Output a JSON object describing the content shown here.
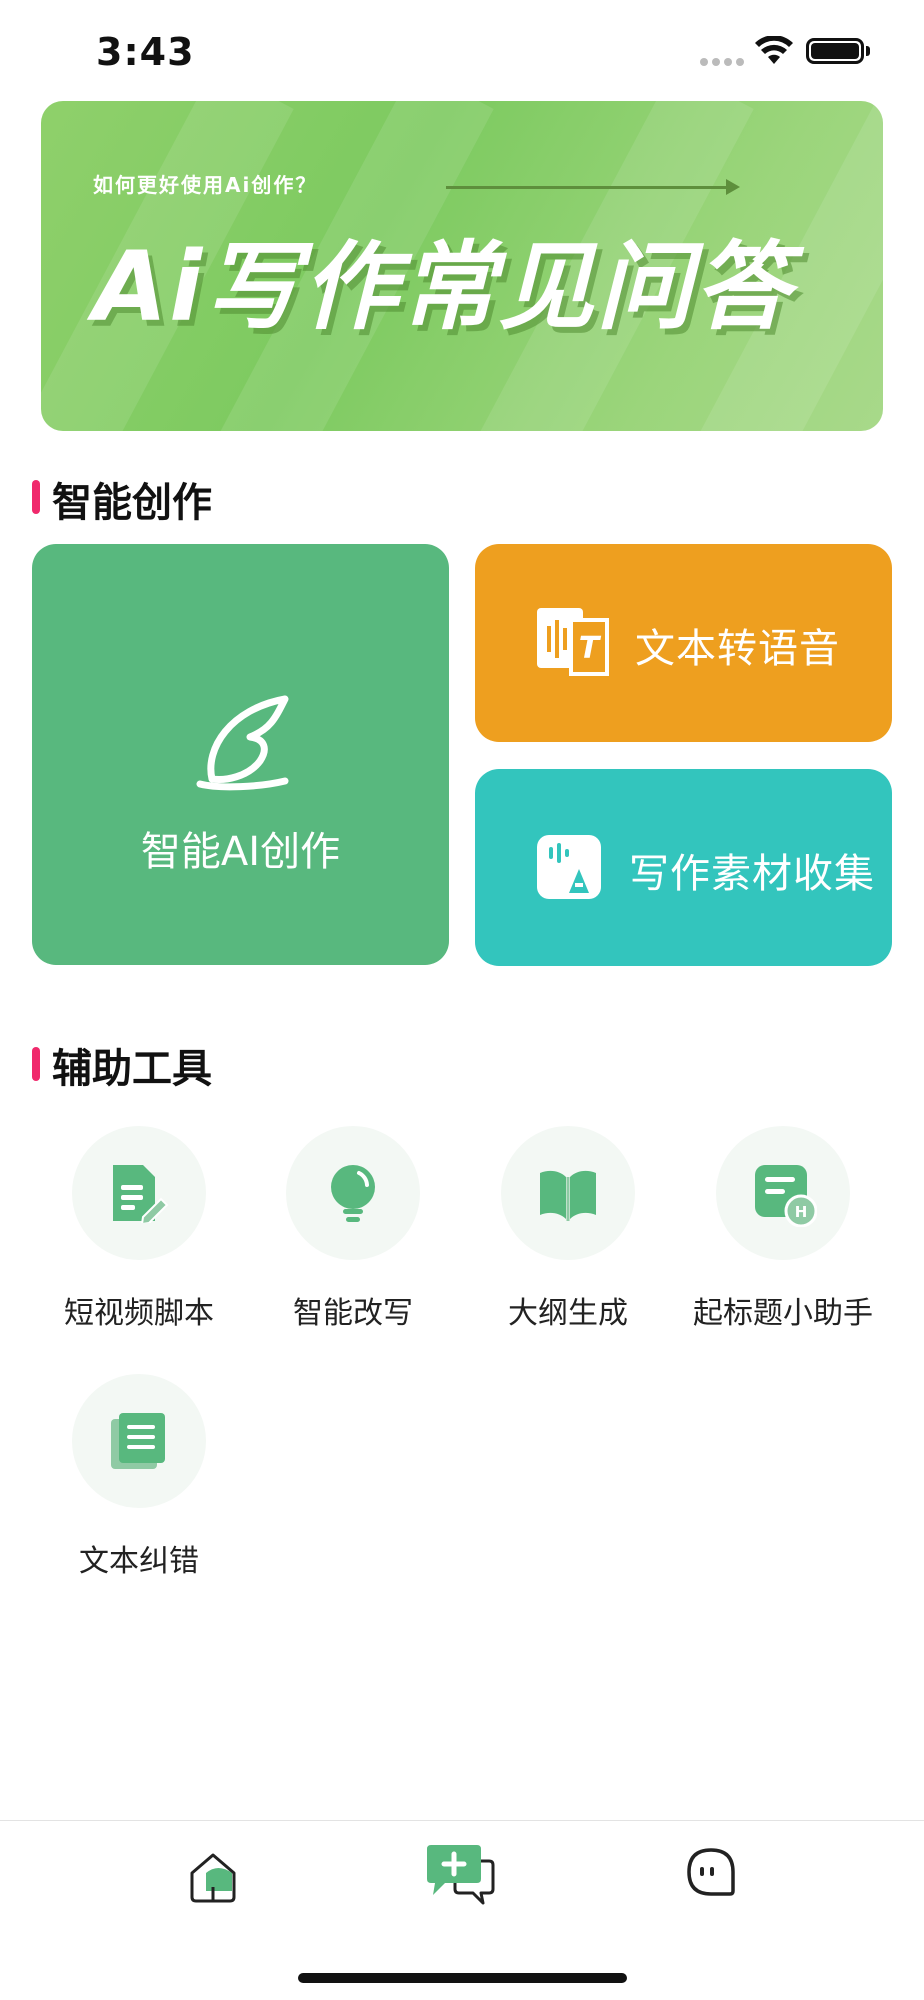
{
  "status_bar": {
    "time": "3:43"
  },
  "banner": {
    "subtitle": "如何更好使用Ai创作？",
    "title": "Ai写作常见问答"
  },
  "sections": {
    "creation": {
      "title": "智能创作"
    },
    "tools": {
      "title": "辅助工具"
    }
  },
  "cards": {
    "main": {
      "label": "智能AI创作",
      "color": "#58b87e",
      "icon": "leaf-pen-icon"
    },
    "tts": {
      "label": "文本转语音",
      "color": "#ee9f1f",
      "icon": "text-to-speech-icon"
    },
    "material": {
      "label": "写作素材收集",
      "color": "#33c5bd",
      "icon": "material-collect-icon"
    }
  },
  "tools": [
    {
      "label": "短视频脚本",
      "icon": "script-document-icon"
    },
    {
      "label": "智能改写",
      "icon": "lightbulb-icon"
    },
    {
      "label": "大纲生成",
      "icon": "open-book-icon"
    },
    {
      "label": "起标题小助手",
      "icon": "heading-assistant-icon"
    },
    {
      "label": "文本纠错",
      "icon": "text-correction-icon"
    }
  ],
  "tabbar": {
    "items": [
      {
        "icon": "home-icon"
      },
      {
        "icon": "create-chat-icon",
        "active": true
      },
      {
        "icon": "profile-face-icon"
      }
    ]
  },
  "colors": {
    "accent_green": "#58b87e",
    "section_bar": "#f0296c"
  }
}
